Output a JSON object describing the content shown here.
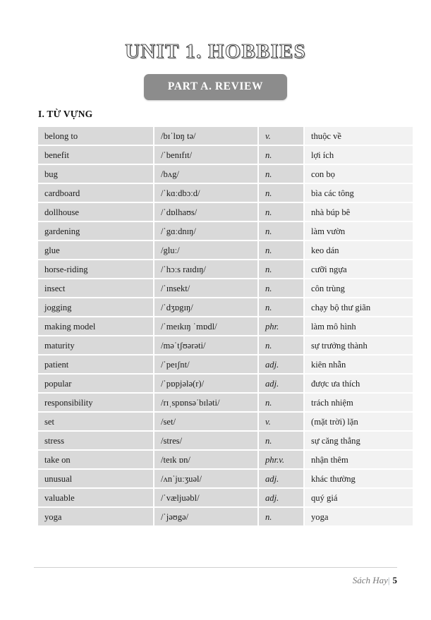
{
  "document": {
    "unit_title": "UNIT 1. HOBBIES",
    "part_banner": "PART A. REVIEW",
    "section_heading": "I. TỪ VỰNG",
    "accent_banner_color": "#8c8c8c",
    "cell_gray_color": "#d9d9d9",
    "cell_light_color": "#f2f2f2"
  },
  "vocabulary": {
    "rows": [
      {
        "word": "belong to",
        "ipa": "/bɪˈlɒŋ tə/",
        "pos": "v.",
        "meaning": "thuộc về"
      },
      {
        "word": "benefit",
        "ipa": "/ˈbenɪfɪt/",
        "pos": "n.",
        "meaning": "lợi ích"
      },
      {
        "word": "bug",
        "ipa": "/bʌg/",
        "pos": "n.",
        "meaning": "con bọ"
      },
      {
        "word": "cardboard",
        "ipa": "/ˈkɑːdbɔːd/",
        "pos": "n.",
        "meaning": "bìa các tông"
      },
      {
        "word": "dollhouse",
        "ipa": "/ˈdɒlhaʊs/",
        "pos": "n.",
        "meaning": "nhà búp bê"
      },
      {
        "word": "gardening",
        "ipa": "/ˈgɑːdnɪŋ/",
        "pos": "n.",
        "meaning": "làm vườn"
      },
      {
        "word": "glue",
        "ipa": "/gluː/",
        "pos": "n.",
        "meaning": "keo dán"
      },
      {
        "word": "horse-riding",
        "ipa": "/ˈhɔːs raɪdɪŋ/",
        "pos": "n.",
        "meaning": "cưỡi ngựa"
      },
      {
        "word": "insect",
        "ipa": "/ˈɪnsekt/",
        "pos": "n.",
        "meaning": "côn trùng"
      },
      {
        "word": "jogging",
        "ipa": "/ˈdʒɒgɪŋ/",
        "pos": "n.",
        "meaning": "chạy bộ thư giãn"
      },
      {
        "word": "making model",
        "ipa": "/ˈmeɪkɪŋ ˈmɒdl/",
        "pos": "phr.",
        "meaning": "làm mô hình"
      },
      {
        "word": "maturity",
        "ipa": "/məˈtʃʊərəti/",
        "pos": "n.",
        "meaning": "sự trưởng thành"
      },
      {
        "word": "patient",
        "ipa": "/ˈpeɪʃnt/",
        "pos": "adj.",
        "meaning": "kiên nhẫn"
      },
      {
        "word": "popular",
        "ipa": "/ˈpɒpjələ(r)/",
        "pos": "adj.",
        "meaning": "được ưa thích"
      },
      {
        "word": "responsibility",
        "ipa": "/rɪˌspɒnsəˈbɪləti/",
        "pos": "n.",
        "meaning": "trách nhiệm"
      },
      {
        "word": "set",
        "ipa": "/set/",
        "pos": "v.",
        "meaning": "(mặt trời) lặn"
      },
      {
        "word": "stress",
        "ipa": "/stres/",
        "pos": "n.",
        "meaning": "sự căng thẳng"
      },
      {
        "word": "take on",
        "ipa": "/teɪk ɒn/",
        "pos": "phr.v.",
        "meaning": "nhận thêm"
      },
      {
        "word": "unusual",
        "ipa": "/ʌnˈjuːʒuəl/",
        "pos": "adj.",
        "meaning": "khác thường"
      },
      {
        "word": "valuable",
        "ipa": "/ˈvæljuəbl/",
        "pos": "adj.",
        "meaning": "quý giá"
      },
      {
        "word": "yoga",
        "ipa": "/ˈjəʊgə/",
        "pos": "n.",
        "meaning": "yoga"
      }
    ]
  },
  "footer": {
    "brand": "Sách Hay",
    "separator": "|",
    "page_number": "5"
  }
}
